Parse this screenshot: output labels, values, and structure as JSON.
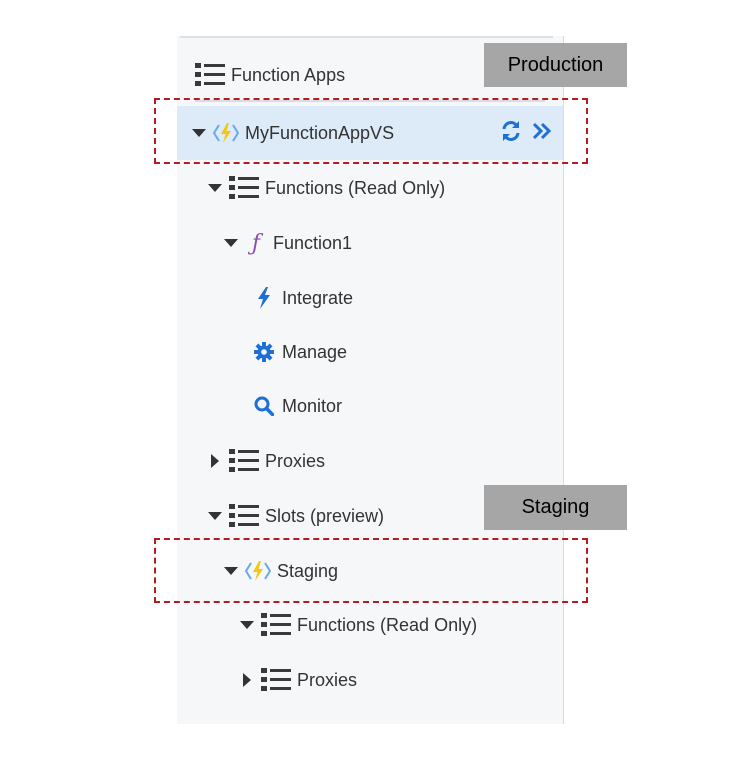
{
  "tree": {
    "root_label": "Function Apps",
    "app": {
      "label": "MyFunctionAppVS"
    },
    "functions_group": "Functions (Read Only)",
    "function1": "Function1",
    "integrate": "Integrate",
    "manage": "Manage",
    "monitor": "Monitor",
    "proxies": "Proxies",
    "slots": "Slots (preview)",
    "staging": "Staging",
    "staging_functions": "Functions (Read Only)",
    "staging_proxies": "Proxies"
  },
  "badges": {
    "production": "Production",
    "staging": "Staging"
  },
  "colors": {
    "accent_blue": "#1e6fd6",
    "bolt_yellow": "#f2c811",
    "dash_red": "#b01e23",
    "function_purple": "#8a4fae"
  }
}
